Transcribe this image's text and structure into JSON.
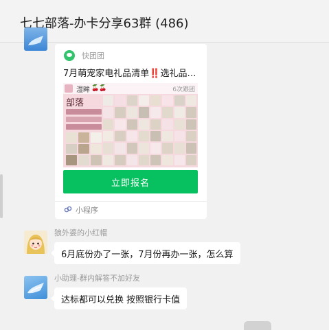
{
  "chat": {
    "title": "七七部落-办卡分享63群 (486)"
  },
  "mini_program": {
    "source_name": "快团团",
    "title": "7月萌宠家电礼品清单‼️选礼品…",
    "preview": {
      "user": "湿眸",
      "cherries": "🍒🍒",
      "followers": "6次跟团",
      "brand_text": "部落"
    },
    "button_label": "立即报名",
    "footer_label": "小程序",
    "icons": {
      "logo": "kuaituantuan-logo-icon",
      "footer": "mini-program-icon"
    }
  },
  "messages": [
    {
      "sender": "狼外婆的小红帽",
      "text": "6月底份办了一张，7月份再办一张，怎么算"
    },
    {
      "sender": "小助理-群内解答不加好友",
      "text": "达标都可以兑换 按照银行卡值"
    }
  ],
  "colors": {
    "accent": "#07c160",
    "background": "#f1f1f1",
    "bubble": "#ffffff"
  }
}
